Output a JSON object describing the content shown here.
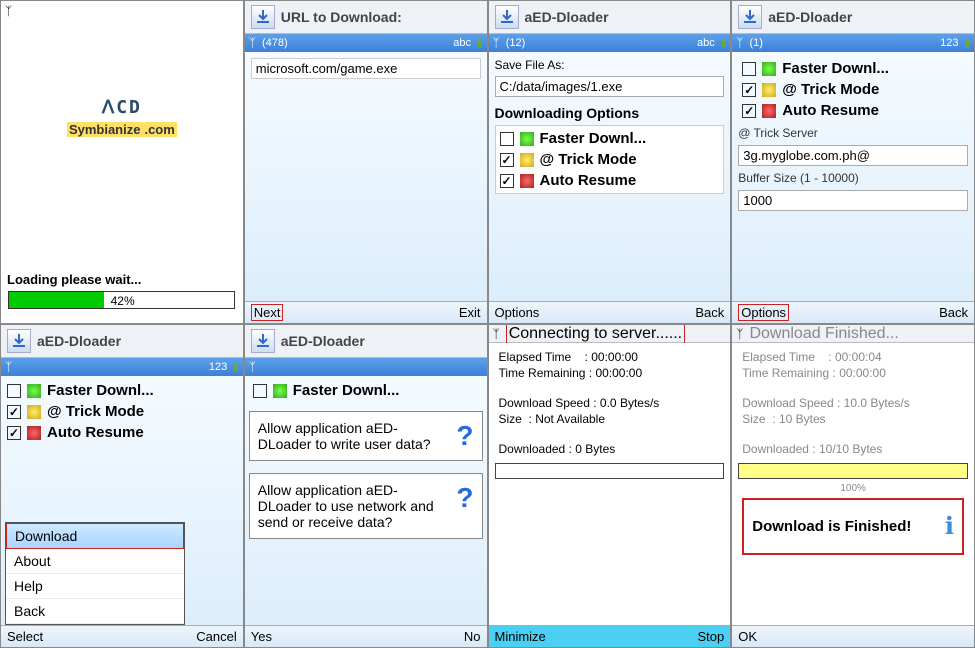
{
  "cell1": {
    "logo_top": "ꓥCD",
    "brand": "Symbianize",
    "brand_suffix": ".com",
    "loading_text": "Loading please wait...",
    "progress_pct": 42,
    "progress_label": "42%"
  },
  "cell2": {
    "header_title": "URL to Download:",
    "counter": "(478)",
    "indicator": "abc",
    "url_value": "microsoft.com/game.exe",
    "sk_left": "Next",
    "sk_right": "Exit"
  },
  "cell3": {
    "header_title": "aED-Dloader",
    "counter": "(12)",
    "indicator": "abc",
    "save_label": "Save File As:",
    "save_value": "C:/data/images/1.exe",
    "options_title": "Downloading Options",
    "opts": [
      {
        "checked": false,
        "name": "Faster Downl..."
      },
      {
        "checked": true,
        "name": "@ Trick Mode"
      },
      {
        "checked": true,
        "name": "Auto Resume"
      }
    ],
    "sk_left": "Options",
    "sk_right": "Back"
  },
  "cell4": {
    "header_title": "aED-Dloader",
    "counter": "(1)",
    "indicator": "123",
    "opts": [
      {
        "checked": false,
        "name": "Faster Downl..."
      },
      {
        "checked": true,
        "name": "@ Trick Mode"
      },
      {
        "checked": true,
        "name": "Auto Resume"
      }
    ],
    "server_label": "@ Trick Server",
    "server_value": "3g.myglobe.com.ph@",
    "buffer_label": "Buffer Size (1 - 10000)",
    "buffer_value": "1000",
    "sk_left": "Options",
    "sk_right": "Back"
  },
  "cell5": {
    "header_title": "aED-Dloader",
    "indicator": "123",
    "opts": [
      {
        "checked": false,
        "name": "Faster Downl..."
      },
      {
        "checked": true,
        "name": "@ Trick Mode"
      },
      {
        "checked": true,
        "name": "Auto Resume"
      }
    ],
    "menu": [
      "Download",
      "About",
      "Help",
      "Back"
    ],
    "sk_left": "Select",
    "sk_right": "Cancel"
  },
  "cell6": {
    "header_title": "aED-Dloader",
    "opt_preview": "Faster Downl...",
    "dialog1": "Allow application aED-DLoader to write user data?",
    "dialog2": "Allow application aED-DLoader to use network and send or receive data?",
    "sk_left": "Yes",
    "sk_right": "No"
  },
  "cell7": {
    "status": "Connecting to server......",
    "elapsed_label": "Elapsed Time",
    "elapsed_value": "00:00:00",
    "remain_label": "Time Remaining",
    "remain_value": "00:00:00",
    "speed_label": "Download Speed",
    "speed_value": "0.0 Bytes/s",
    "size_label": "Size",
    "size_value": "Not Available",
    "downloaded_label": "Downloaded",
    "downloaded_value": "0 Bytes",
    "sk_left": "Minimize",
    "sk_right": "Stop"
  },
  "cell8": {
    "status": "Download Finished...",
    "elapsed_label": "Elapsed Time",
    "elapsed_value": "00:00:04",
    "remain_label": "Time Remaining",
    "remain_value": "00:00:00",
    "speed_label": "Download Speed",
    "speed_value": "10.0 Bytes/s",
    "size_label": "Size",
    "size_value": "10 Bytes",
    "downloaded_label": "Downloaded",
    "downloaded_value": "10/10 Bytes",
    "prog_label": "100%",
    "finished_text": "Download is Finished!",
    "sk_left": "OK",
    "sk_right": ""
  }
}
